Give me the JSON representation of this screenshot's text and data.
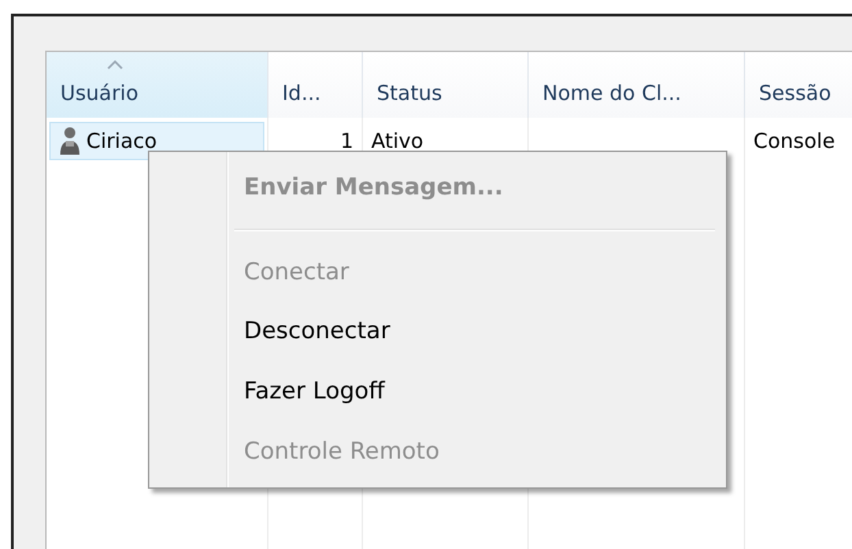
{
  "table": {
    "columns": [
      {
        "label": "Usuário",
        "sorted": true
      },
      {
        "label": "Id...",
        "sorted": false
      },
      {
        "label": "Status",
        "sorted": false
      },
      {
        "label": "Nome do Cl...",
        "sorted": false
      },
      {
        "label": "Sessão",
        "sorted": false
      }
    ],
    "rows": [
      {
        "selected": true,
        "cells": [
          "Ciriaco",
          "1",
          "Ativo",
          "",
          "Console"
        ]
      }
    ]
  },
  "context_menu": {
    "items": [
      {
        "kind": "item",
        "label": "Enviar Mensagem...",
        "bold": true,
        "disabled": true
      },
      {
        "kind": "separator"
      },
      {
        "kind": "item",
        "label": "Conectar",
        "bold": false,
        "disabled": true
      },
      {
        "kind": "item",
        "label": "Desconectar",
        "bold": false,
        "disabled": false
      },
      {
        "kind": "item",
        "label": "Fazer Logoff",
        "bold": false,
        "disabled": false
      },
      {
        "kind": "item",
        "label": "Controle Remoto",
        "bold": false,
        "disabled": true
      }
    ]
  }
}
